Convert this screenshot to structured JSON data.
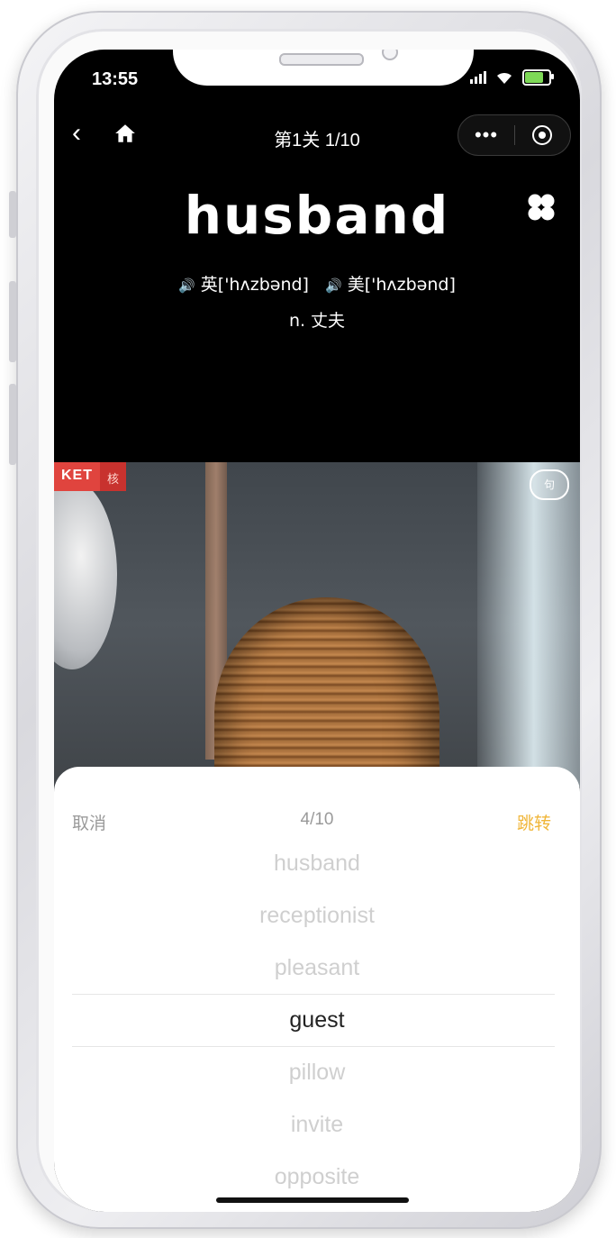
{
  "status_bar": {
    "time": "13:55"
  },
  "nav": {
    "back_icon": "chevron-left",
    "home_icon": "home",
    "title": "第1关 1/10",
    "more_glyph": "•••",
    "close_icon": "target-circle"
  },
  "word_card": {
    "word": "husband",
    "uk_label": "英['hʌzbənd]",
    "us_label": "美['hʌzbənd]",
    "speaker_glyph": "🔊",
    "meaning": "n. 丈夫",
    "menu_icon": "four-petal-grid"
  },
  "video": {
    "badge_level": "KET",
    "badge_core": "核",
    "sentence_button": "句"
  },
  "picker_sheet": {
    "cancel_label": "取消",
    "progress": "4/10",
    "jump_label": "跳转",
    "items": [
      "husband",
      "receptionist",
      "pleasant",
      "guest",
      "pillow",
      "invite",
      "opposite"
    ],
    "selected_index": 3
  },
  "colors": {
    "accent_orange": "#e8a55b",
    "jump_yellow": "#f0b63a",
    "badge_red": "#e0443e"
  }
}
